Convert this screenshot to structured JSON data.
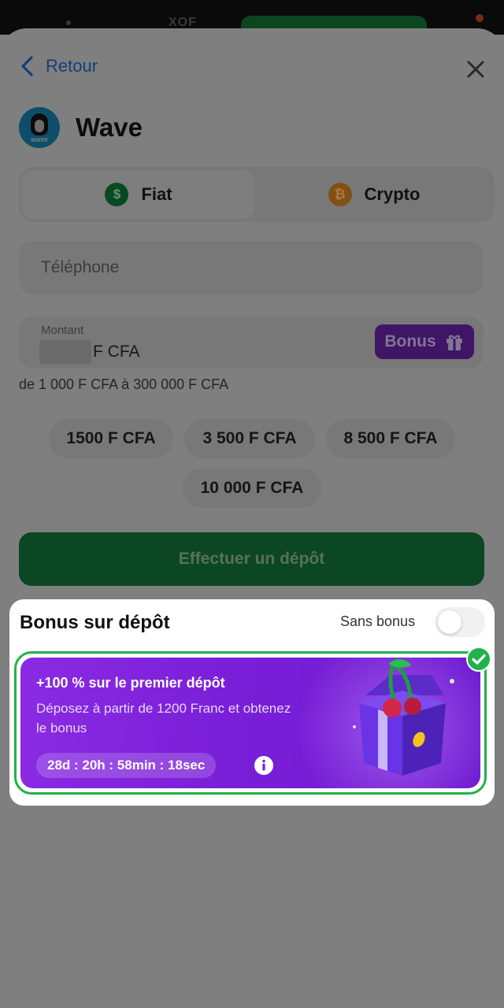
{
  "status": {
    "currency": "XOF"
  },
  "header": {
    "back_label": "Retour"
  },
  "provider": {
    "name": "Wave",
    "logo_text": "wave"
  },
  "tabs": [
    {
      "label": "Fiat",
      "icon": "dollar-coin-icon",
      "symbol": "$",
      "active": true
    },
    {
      "label": "Crypto",
      "icon": "bitcoin-icon",
      "symbol": "₿",
      "active": false
    }
  ],
  "phone": {
    "placeholder": "Téléphone"
  },
  "amount": {
    "label": "Montant",
    "unit": "F CFA",
    "bonus_label": "Bonus"
  },
  "range_text": "de 1 000 F CFA à 300 000 F CFA",
  "chips": [
    "1500 F CFA",
    "3 500 F CFA",
    "8 500 F CFA",
    "10 000 F CFA"
  ],
  "deposit_button": "Effectuer un dépôt",
  "bonus_panel": {
    "title": "Bonus sur dépôt",
    "sans_bonus": "Sans bonus",
    "toggle_on": false,
    "offer": {
      "title": "+100 % sur le premier dépôt",
      "description": "Déposez à partir de 1200 Franc et obtenez le bonus",
      "timer": "28d : 20h : 58min : 18sec",
      "selected": true
    }
  },
  "colors": {
    "accent_green": "#21b24a",
    "offer_purple": "#7a1fd8",
    "link_blue": "#123f7b"
  }
}
